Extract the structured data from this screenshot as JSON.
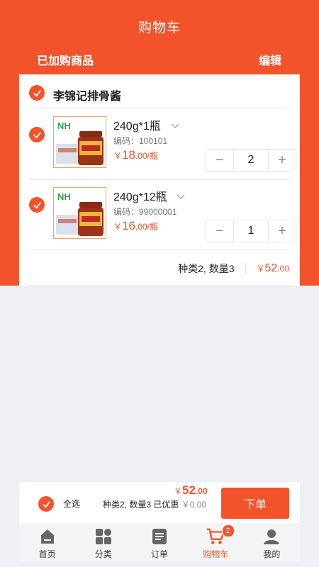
{
  "header": {
    "title": "购物车",
    "subtitle": "已加购商品",
    "edit_label": "编辑"
  },
  "store": {
    "name": "李锦记排骨酱"
  },
  "items": [
    {
      "name": "240g*1瓶",
      "code": "编码：100101",
      "price_currency": "￥",
      "price_int": "18",
      "price_dec": ".00/瓶",
      "quantity": "2",
      "logo_text": "NH"
    },
    {
      "name": "240g*12瓶",
      "code": "编码：99000001",
      "price_currency": "￥",
      "price_int": "16",
      "price_dec": ".00/瓶",
      "quantity": "1",
      "logo_text": "NH"
    }
  ],
  "stepper": {
    "minus": "−",
    "plus": "+"
  },
  "store_summary": {
    "text": "种类2, 数量3",
    "currency": "￥",
    "total_int": "52",
    "total_dec": ".00"
  },
  "bottom": {
    "select_all": "全选",
    "summary": "种类2, 数量3 已优惠",
    "discount": "￥0.00",
    "currency": "￥",
    "total_int": "52",
    "total_dec": ".00",
    "order_button": "下单"
  },
  "tabs": [
    {
      "label": "首页",
      "icon": "home-icon"
    },
    {
      "label": "分类",
      "icon": "category-icon"
    },
    {
      "label": "订单",
      "icon": "order-icon"
    },
    {
      "label": "购物车",
      "icon": "cart-icon",
      "badge": "2"
    },
    {
      "label": "我的",
      "icon": "user-icon"
    }
  ],
  "colors": {
    "accent": "#f2532a",
    "background": "#eef0f6"
  }
}
